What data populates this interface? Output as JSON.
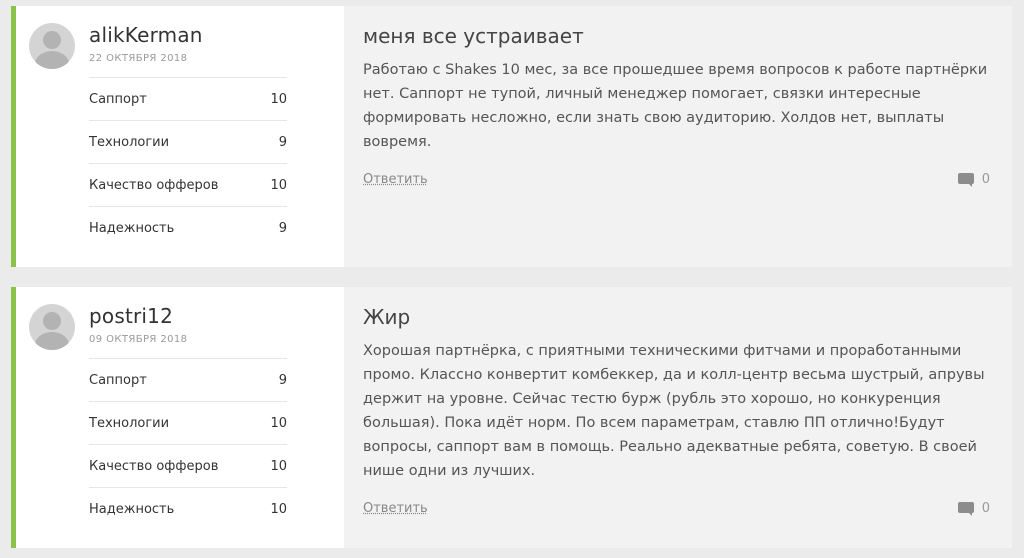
{
  "reviews": [
    {
      "username": "alikKerman",
      "date": "22 ОКТЯБРЯ 2018",
      "ratings": [
        {
          "label": "Саппорт",
          "value": "10"
        },
        {
          "label": "Технологии",
          "value": "9"
        },
        {
          "label": "Качество офферов",
          "value": "10"
        },
        {
          "label": "Надежность",
          "value": "9"
        }
      ],
      "title": "меня все устраивает",
      "text": "Работаю с Shakes 10 мес, за все прошедшее время вопросов к работе партнёрки нет. Саппорт не тупой, личный менеджер помогает, связки интересные формировать несложно, если знать свою аудиторию. Холдов нет, выплаты вовремя.",
      "reply_label": "Ответить",
      "comments_count": "0"
    },
    {
      "username": "postri12",
      "date": "09 ОКТЯБРЯ 2018",
      "ratings": [
        {
          "label": "Саппорт",
          "value": "9"
        },
        {
          "label": "Технологии",
          "value": "10"
        },
        {
          "label": "Качество офферов",
          "value": "10"
        },
        {
          "label": "Надежность",
          "value": "10"
        }
      ],
      "title": "Жир",
      "text": "Хорошая партнёрка, с приятными техническими фитчами и проработанными промо. Классно конвертит комбеккер, да и колл-центр весьма шустрый, апрувы держит на уровне. Сейчас тестю бурж (рубль это хорошо, но конкуренция большая). Пока идёт норм. По всем параметрам, ставлю ПП отлично!Будут вопросы, саппорт вам в помощь. Реально адекватные ребята, советую. В своей нише одни из лучших.",
      "reply_label": "Ответить",
      "comments_count": "0"
    }
  ],
  "colors": {
    "accent": "#8bc34a",
    "card_bg": "#f2f2f2",
    "page_bg": "#ebebeb"
  },
  "icons": {
    "avatar": "user-avatar-icon",
    "comments": "comment-bubble-icon"
  }
}
